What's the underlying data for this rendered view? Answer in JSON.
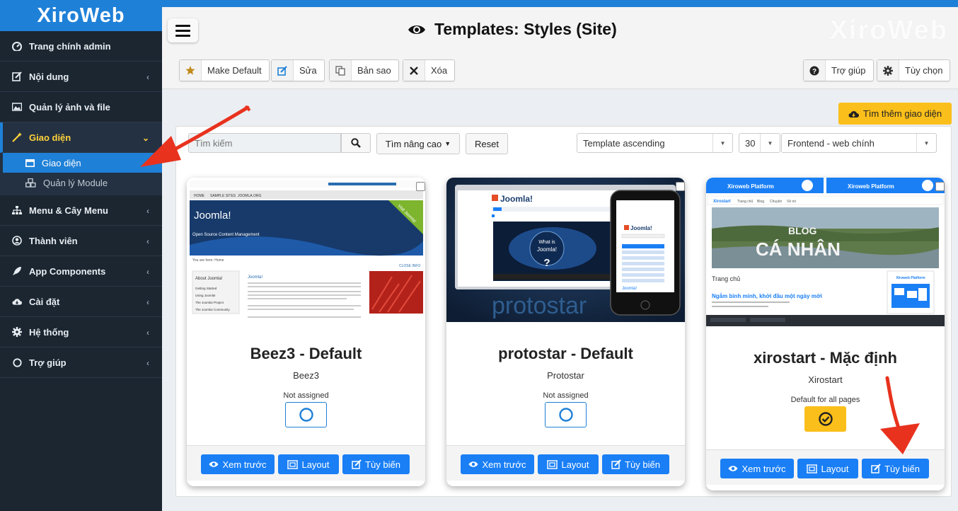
{
  "sidebar": {
    "logo": "XiroWeb",
    "items": [
      {
        "label": "Trang chính admin",
        "icon": "dashboard-icon"
      },
      {
        "label": "Nội dung",
        "icon": "edit-icon"
      },
      {
        "label": "Quản lý ảnh và file",
        "icon": "image-icon"
      },
      {
        "label": "Giao diện",
        "icon": "magic-wand-icon",
        "active": true
      },
      {
        "label": "Menu & Cây Menu",
        "icon": "sitemap-icon"
      },
      {
        "label": "Thành viên",
        "icon": "user-icon"
      },
      {
        "label": "App Components",
        "icon": "rocket-icon"
      },
      {
        "label": "Cài đặt",
        "icon": "cloud-download-icon"
      },
      {
        "label": "Hệ thống",
        "icon": "gear-icon"
      },
      {
        "label": "Trợ giúp",
        "icon": "circle-icon"
      }
    ],
    "submenu": [
      {
        "label": "Giao diện",
        "icon": "window-icon",
        "active": true
      },
      {
        "label": "Quản lý Module",
        "icon": "cubes-icon"
      }
    ]
  },
  "header": {
    "title": "Templates: Styles (Site)",
    "watermark": "XiroWeb"
  },
  "toolbar": {
    "make_default": "Make Default",
    "edit": "Sửa",
    "copy": "Bản sao",
    "delete": "Xóa",
    "help": "Trợ giúp",
    "options": "Tùy chọn"
  },
  "find_more": "Tìm thêm giao diện",
  "filters": {
    "search_placeholder": "Tìm kiếm",
    "advanced": "Tìm nâng cao",
    "reset": "Reset",
    "ordering": "Template ascending",
    "limit": "30",
    "client": "Frontend - web chính"
  },
  "cards": [
    {
      "title": "Beez3 - Default",
      "template": "Beez3",
      "status": "Not assigned",
      "default": false,
      "preview": "Xem trước",
      "layout": "Layout",
      "customize": "Tùy biến",
      "thumb": {
        "nav": [
          "HOME",
          "SAMPLE SITES",
          "JOOMLA.ORG"
        ],
        "brand": "Joomla!",
        "tagline": "Open Source Content Management",
        "ribbon": "Visit Joomla!",
        "breadcrumb": "You are here: Home",
        "close": "CLOSE INFO",
        "side_title": "About Joomla!",
        "side_links": [
          "Getting Started",
          "Using Joomla!",
          "The Joomla! Project",
          "The Joomla! Community"
        ],
        "article_title": "Joomla!"
      }
    },
    {
      "title": "protostar - Default",
      "template": "Protostar",
      "status": "Not assigned",
      "default": false,
      "preview": "Xem trước",
      "layout": "Layout",
      "customize": "Tùy biến",
      "thumb": {
        "brand": "Joomla!",
        "video_line1": "What is",
        "video_line2": "Joomla!",
        "video_mark": "?",
        "phone_brand": "Joomla!",
        "phone_heading": "Joomla!",
        "wordmark": "protostar"
      }
    },
    {
      "title": "xirostart - Mặc định",
      "template": "Xirostart",
      "status": "Default for all pages",
      "default": true,
      "preview": "Xem trước",
      "layout": "Layout",
      "customize": "Tùy biến",
      "thumb": {
        "banner": "Xiroweb Platform",
        "nav": [
          "Xirostart",
          "Trang chủ",
          "Blog",
          "Chuyện",
          "Về nó"
        ],
        "hero1": "BLOG",
        "hero2": "CÁ NHÂN",
        "heading": "Trang chủ",
        "post_title": "Ngắm bình minh, khởi đầu một ngày mới",
        "widget": "Xiroweb Platform"
      }
    }
  ],
  "colors": {
    "primary": "#1a7ff5",
    "accent": "#fbbf1b",
    "sidebar": "#1b2631",
    "annotation_arrow": "#e8321e"
  }
}
